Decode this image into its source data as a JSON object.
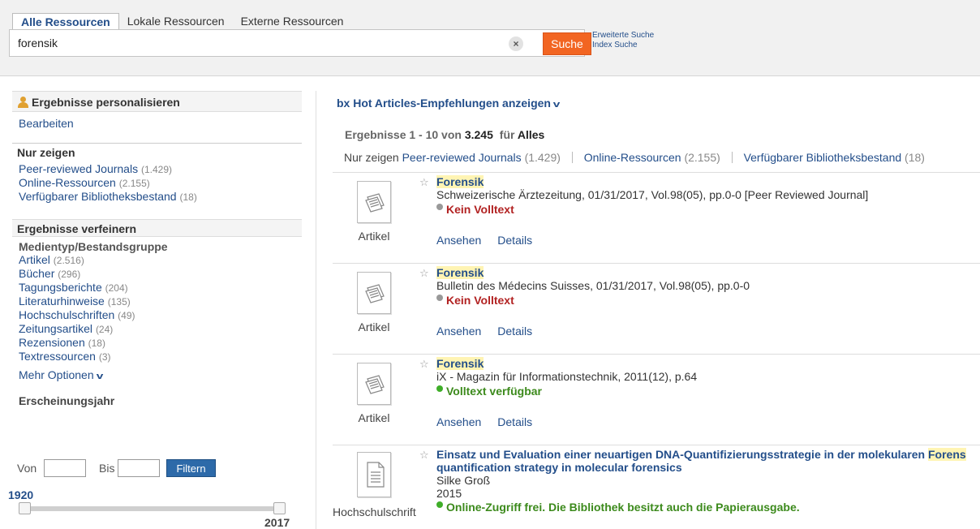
{
  "tabs": [
    "Alle Ressourcen",
    "Lokale Ressourcen",
    "Externe Ressourcen"
  ],
  "search": {
    "value": "forensik",
    "button": "Suche",
    "clear": "×",
    "adv_search": "Erweiterte Suche",
    "index_search": "Index Suche"
  },
  "sidebar": {
    "personalize_title": "Ergebnisse personalisieren",
    "edit_link": "Bearbeiten",
    "show_only_title": "Nur zeigen",
    "show_only": [
      {
        "label": "Peer-reviewed Journals",
        "count": "(1.429)"
      },
      {
        "label": "Online-Ressourcen",
        "count": "(2.155)"
      },
      {
        "label": "Verfügbarer Bibliotheksbestand",
        "count": "(18)"
      }
    ],
    "refine_title": "Ergebnisse verfeinern",
    "media_title": "Medientyp/Bestandsgruppe",
    "media": [
      {
        "label": "Artikel",
        "count": "(2.516)"
      },
      {
        "label": "Bücher",
        "count": "(296)"
      },
      {
        "label": "Tagungsberichte",
        "count": "(204)"
      },
      {
        "label": "Literaturhinweise",
        "count": "(135)"
      },
      {
        "label": "Hochschulschriften",
        "count": "(49)"
      },
      {
        "label": "Zeitungsartikel",
        "count": "(24)"
      },
      {
        "label": "Rezensionen",
        "count": "(18)"
      },
      {
        "label": "Textressourcen",
        "count": "(3)"
      }
    ],
    "more_options": "Mehr Optionen",
    "year_title": "Erscheinungsjahr",
    "year_from_label": "Von",
    "year_to_label": "Bis",
    "filter_button": "Filtern",
    "year_min": "1920",
    "year_max": "2017"
  },
  "main": {
    "hot_articles": "bx Hot Articles-Empfehlungen anzeigen",
    "summary_prefix": "Ergebnisse 1 - 10 von",
    "summary_count": "3.245",
    "summary_for": "für",
    "summary_scope": "Alles",
    "filter_label": "Nur zeigen",
    "filters": [
      {
        "label": "Peer-reviewed Journals",
        "count": "(1.429)"
      },
      {
        "label": "Online-Ressourcen",
        "count": "(2.155)"
      },
      {
        "label": "Verfügbarer Bibliotheksbestand",
        "count": "(18)"
      }
    ],
    "results": [
      {
        "type": "Artikel",
        "title": "Forensik",
        "source": "Schweizerische Ärztezeitung, 01/31/2017, Vol.98(05), pp.0-0 [Peer Reviewed Journal]",
        "status": "Kein Volltext",
        "action_view": "Ansehen",
        "action_details": "Details"
      },
      {
        "type": "Artikel",
        "title": "Forensik",
        "source": "Bulletin des Médecins Suisses, 01/31/2017, Vol.98(05), pp.0-0",
        "status": "Kein Volltext",
        "action_view": "Ansehen",
        "action_details": "Details"
      },
      {
        "type": "Artikel",
        "title": "Forensik",
        "source": "iX - Magazin für Informationstechnik, 2011(12), p.64",
        "status": "Volltext verfügbar",
        "action_view": "Ansehen",
        "action_details": "Details"
      },
      {
        "type": "Hochschulschrift",
        "title_part1": "Einsatz und Evaluation einer neuartigen DNA-Quantifizierungsstrategie in der molekularen",
        "title_hl": "Forens",
        "title_line2": "quantification strategy in molecular forensics",
        "author": "Silke Groß",
        "year": "2015",
        "status": "Online-Zugriff frei. Die Bibliothek besitzt auch die Papierausgabe."
      }
    ]
  }
}
